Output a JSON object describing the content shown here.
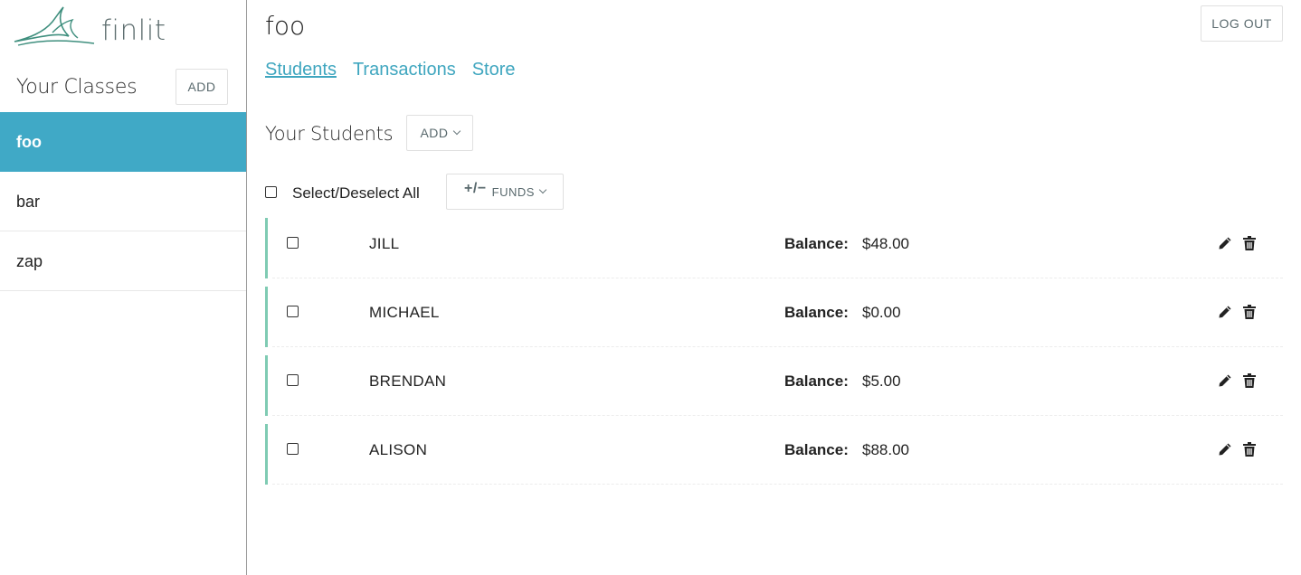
{
  "app": {
    "logo_text": "finlit"
  },
  "sidebar": {
    "title": "Your Classes",
    "add_label": "ADD",
    "classes": [
      {
        "label": "foo",
        "active": true
      },
      {
        "label": "bar",
        "active": false
      },
      {
        "label": "zap",
        "active": false
      }
    ]
  },
  "header": {
    "title": "foo",
    "logout_label": "LOG OUT"
  },
  "tabs": [
    {
      "label": "Students",
      "active": true
    },
    {
      "label": "Transactions",
      "active": false
    },
    {
      "label": "Store",
      "active": false
    }
  ],
  "students_section": {
    "title": "Your Students",
    "add_label": "ADD",
    "select_all_label": "Select/Deselect All",
    "funds_sign": "+/−",
    "funds_label": "FUNDS",
    "balance_label": "Balance:"
  },
  "students": [
    {
      "name": "JILL",
      "balance": "$48.00"
    },
    {
      "name": "MICHAEL",
      "balance": "$0.00"
    },
    {
      "name": "BRENDAN",
      "balance": "$5.00"
    },
    {
      "name": "ALISON",
      "balance": "$88.00"
    }
  ],
  "colors": {
    "accent": "#40a9c6",
    "link": "#3fa6bf",
    "row_bar": "#7fcbb3",
    "logo": "#3f8f7e"
  },
  "icons": {
    "edit": "pencil-icon",
    "delete": "trash-icon",
    "dropdown": "chevron-down-icon"
  }
}
